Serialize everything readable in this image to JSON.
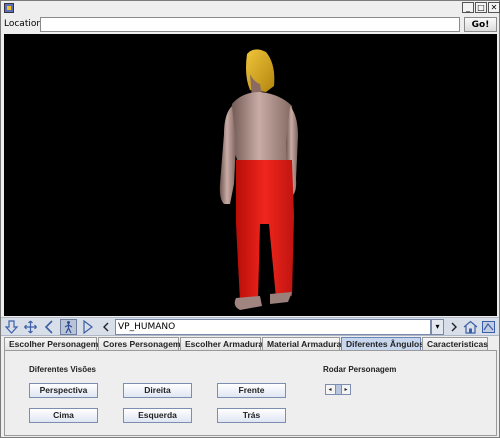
{
  "window": {
    "minimize": "_",
    "maximize": "□",
    "close": "✕"
  },
  "location": {
    "label": "Location:",
    "value": "",
    "go_label": "Go!"
  },
  "navigation": {
    "viewpoint": "VP_HUMANO",
    "dropdown_glyph": "▾"
  },
  "tabs": [
    {
      "label": "Escolher Personagem"
    },
    {
      "label": "Cores Personagem"
    },
    {
      "label": "Escolher Armadura"
    },
    {
      "label": "Material Armadura"
    },
    {
      "label": "Diferentes Ângulos",
      "active": true
    },
    {
      "label": "Caracteristicas"
    }
  ],
  "panel": {
    "views_title": "Diferentes Visões",
    "rotate_title": "Rodar Personagem",
    "buttons": {
      "perspectiva": "Perspectiva",
      "direita": "Direita",
      "frente": "Frente",
      "cima": "Cima",
      "esquerda": "Esquerda",
      "tras": "Trás"
    },
    "spinner": {
      "left": "◂",
      "right": "▸"
    }
  },
  "colors": {
    "viewport_bg": "#000000",
    "pants": "#e8201a",
    "skin": "#b89a92",
    "hair": "#d9a81a",
    "active_tab": "#c8d6ee"
  },
  "icons": [
    "app-icon",
    "arrow-down-icon",
    "move-icon",
    "back-icon",
    "walk-icon",
    "play-icon",
    "prev-viewpoint-icon",
    "next-viewpoint-icon",
    "home-icon",
    "settings-icon"
  ]
}
